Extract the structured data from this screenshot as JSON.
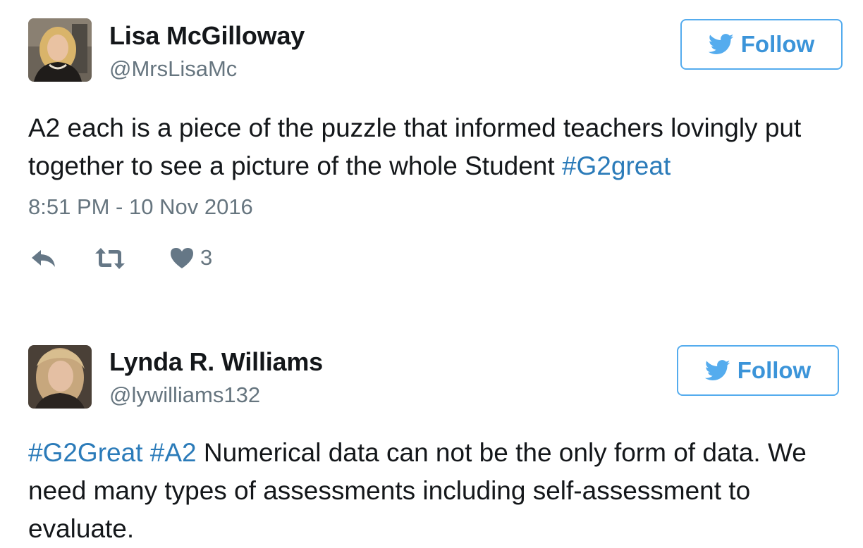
{
  "colors": {
    "link": "#2b7bb9",
    "follow_accent": "#3b94d9",
    "follow_border": "#55acee",
    "meta_gray": "#66757f",
    "icon_gray": "#657786",
    "text": "#14171a"
  },
  "tweets": [
    {
      "author": {
        "name": "Lisa McGilloway",
        "handle": "@MrsLisaMc",
        "avatar_icon": "user-avatar-photo"
      },
      "follow_label": "Follow",
      "follow_icon": "twitter-bird-icon",
      "text_parts": [
        {
          "text": "A2 each is a piece of the puzzle that informed teachers lovingly put together to see a picture of the whole Student ",
          "hashtag": false
        },
        {
          "text": "#G2great",
          "hashtag": true
        }
      ],
      "timestamp": "8:51 PM - 10 Nov 2016",
      "actions": {
        "reply_icon": "reply-icon",
        "retweet_icon": "retweet-icon",
        "like_icon": "heart-icon",
        "like_count": "3"
      }
    },
    {
      "author": {
        "name": "Lynda R. Williams",
        "handle": "@lywilliams132",
        "avatar_icon": "user-avatar-photo"
      },
      "follow_label": "Follow",
      "follow_icon": "twitter-bird-icon",
      "text_parts": [
        {
          "text": "#G2Great",
          "hashtag": true
        },
        {
          "text": " ",
          "hashtag": false
        },
        {
          "text": "#A2",
          "hashtag": true
        },
        {
          "text": " Numerical data can not be the only form of data. We need many types of assessments including self-assessment to evaluate.",
          "hashtag": false
        }
      ]
    }
  ]
}
